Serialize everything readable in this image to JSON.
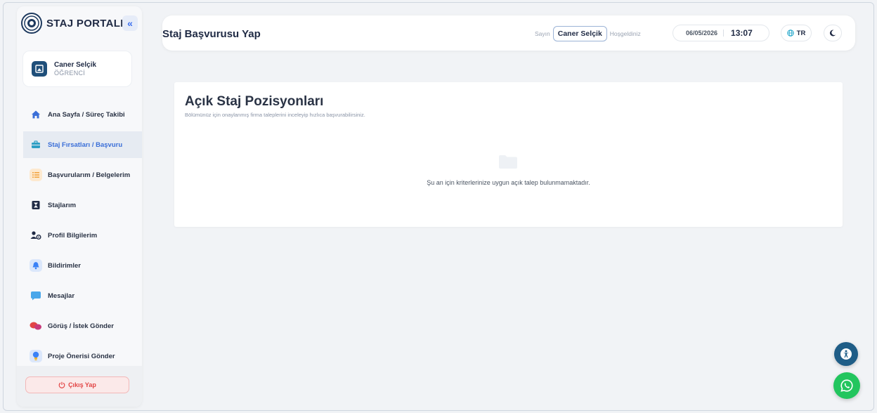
{
  "brand": {
    "title": "STAJ PORTALI",
    "collapse_glyph": "«"
  },
  "user": {
    "name": "Caner Selçik",
    "role": "ÖĞRENCİ"
  },
  "nav": {
    "items": [
      {
        "label": "Ana Sayfa / Süreç Takibi",
        "icon": "home-icon",
        "color": "#3b6fd8",
        "active": false
      },
      {
        "label": "Staj Fırsatları / Başvuru",
        "icon": "briefcase-icon",
        "color": "#3aa0c8",
        "active": true
      },
      {
        "label": "Başvurularım / Belgelerim",
        "icon": "list-icon",
        "color": "#f2a33c",
        "active": false
      },
      {
        "label": "Stajlarım",
        "icon": "hourglass-icon",
        "color": "#1f2a44",
        "active": false
      },
      {
        "label": "Profil Bilgilerim",
        "icon": "user-gear-icon",
        "color": "#1f2a44",
        "active": false
      },
      {
        "label": "Bildirimler",
        "icon": "bell-icon",
        "color": "#3b82f6",
        "active": false
      },
      {
        "label": "Mesajlar",
        "icon": "message-icon",
        "color": "#3aa0e8",
        "active": false
      },
      {
        "label": "Görüş / İstek Gönder",
        "icon": "chat-bubbles-icon",
        "color": "#e24545",
        "active": false
      },
      {
        "label": "Proje Önerisi Gönder",
        "icon": "lightbulb-icon",
        "color": "#3b82f6",
        "active": false
      }
    ]
  },
  "logout": {
    "label": "Çıkış Yap"
  },
  "header": {
    "title": "Staj Başvurusu Yap",
    "greeting_prefix": "Sayın",
    "greeting_name": "Caner Selçik",
    "greeting_suffix": "Hoşgeldiniz",
    "date": "06/05/2026",
    "time": "13:07",
    "language": "TR"
  },
  "main": {
    "title": "Açık Staj Pozisyonları",
    "subtitle": "Bölümünüz için onaylanmış firma taleplerini inceleyip hızlıca başvurabilirsiniz.",
    "empty_message": "Şu an için kriterlerinize uygun açık talep bulunmamaktadır."
  },
  "colors": {
    "accent": "#3b6fd8",
    "danger": "#e24545",
    "whatsapp": "#22c55e",
    "accessibility": "#1f5d87"
  }
}
